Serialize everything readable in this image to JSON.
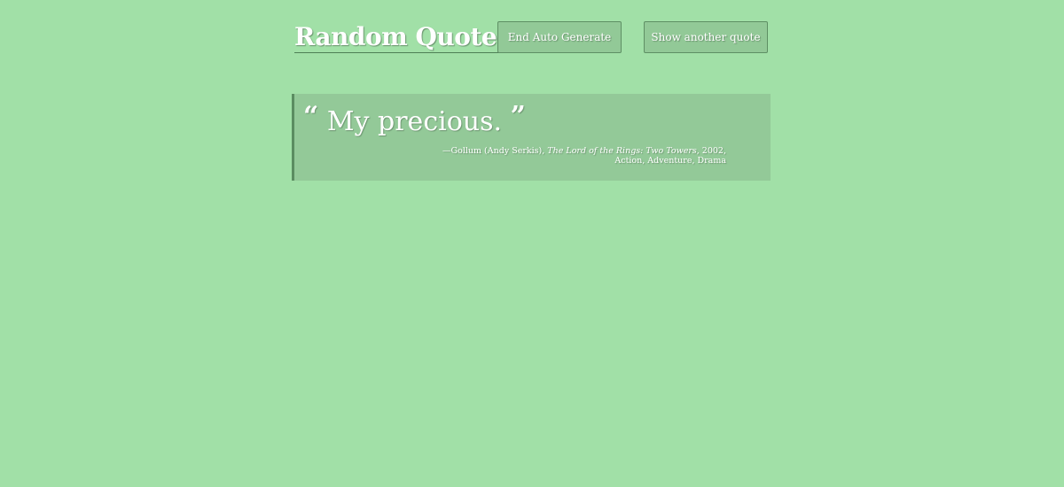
{
  "header": {
    "title": "Random Quotes",
    "end_auto_label": "End Auto Generate",
    "show_another_label": "Show another quote"
  },
  "quote": {
    "open_mark": "“",
    "text": "My precious.",
    "close_mark": "”",
    "dash": "—",
    "character": "Gollum (Andy Serkis), ",
    "film": "The Lord of the Rings: Two Towers",
    "year": ", 2002,",
    "genres": "Action, Adventure, Drama"
  },
  "colors": {
    "background": "#a1e0a7",
    "panel": "#93c998",
    "accent_border": "#5b8d61",
    "text": "#ffffff"
  }
}
